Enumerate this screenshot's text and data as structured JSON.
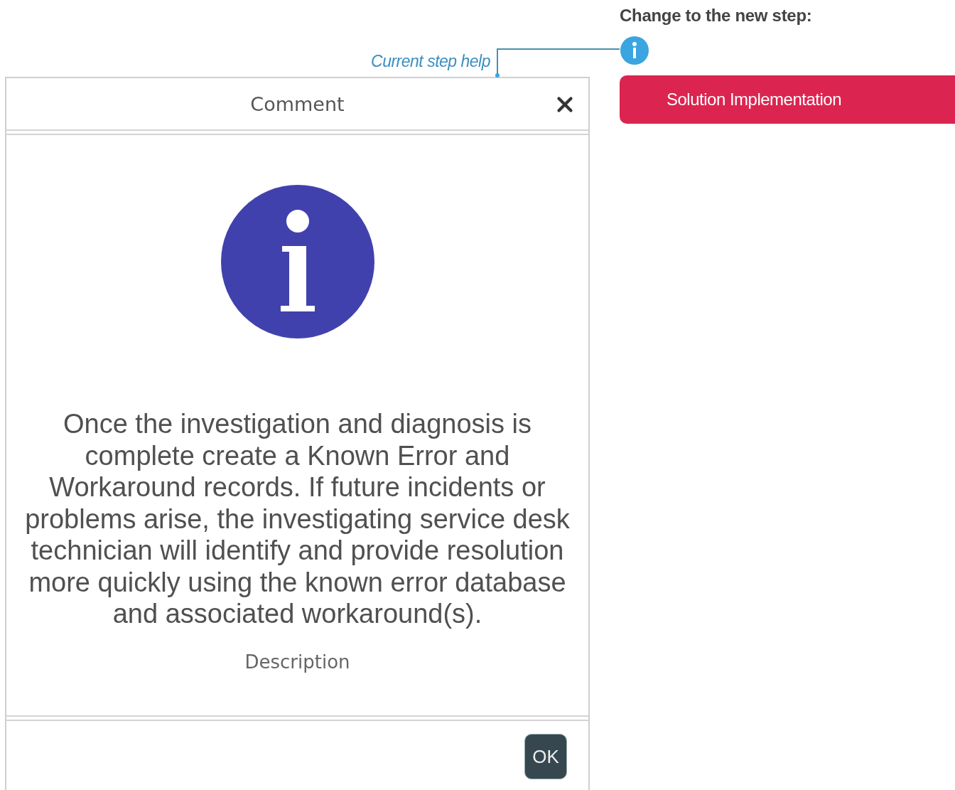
{
  "step_help": {
    "label": "Current step help"
  },
  "dialog": {
    "title": "Comment",
    "message": "Once the investigation and diagnosis is complete create a Known Error and Workaround records. If future incidents or problems arise, the investigating service desk technician will identify and provide resolution more quickly using the known error database and associated workaround(s).",
    "field_label": "Description",
    "buttons": [
      "OK"
    ]
  },
  "new_step": {
    "heading": "Change to the new step:",
    "step_button": "Solution Implementation"
  }
}
